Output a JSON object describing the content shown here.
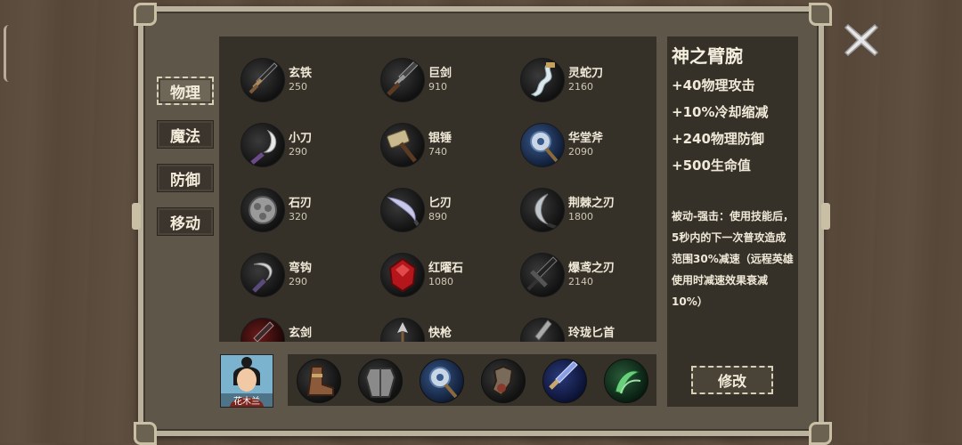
{
  "tabs": [
    {
      "label": "物理",
      "active": true
    },
    {
      "label": "魔法",
      "active": false
    },
    {
      "label": "防御",
      "active": false
    },
    {
      "label": "移动",
      "active": false
    }
  ],
  "items": [
    {
      "name": "玄铁",
      "price": "250",
      "icon": "dark-sword-icon"
    },
    {
      "name": "巨剑",
      "price": "910",
      "icon": "greatsword-icon"
    },
    {
      "name": "灵蛇刀",
      "price": "2160",
      "icon": "serpent-blade-icon"
    },
    {
      "name": "小刀",
      "price": "290",
      "icon": "small-knife-icon"
    },
    {
      "name": "银锤",
      "price": "740",
      "icon": "silver-hammer-icon"
    },
    {
      "name": "华堂斧",
      "price": "2090",
      "icon": "ornate-axe-icon"
    },
    {
      "name": "石刃",
      "price": "320",
      "icon": "stone-blade-icon"
    },
    {
      "name": "匕刃",
      "price": "890",
      "icon": "dagger-blade-icon"
    },
    {
      "name": "荆棘之刃",
      "price": "1800",
      "icon": "thorn-blade-icon"
    },
    {
      "name": "弯钩",
      "price": "290",
      "icon": "hook-icon"
    },
    {
      "name": "红曜石",
      "price": "1080",
      "icon": "red-gem-icon"
    },
    {
      "name": "爆鸢之刃",
      "price": "2140",
      "icon": "kite-blade-icon"
    },
    {
      "name": "玄剑",
      "price": "",
      "icon": "dark-blade-icon"
    },
    {
      "name": "快枪",
      "price": "",
      "icon": "spear-icon"
    },
    {
      "name": "玲珑匕首",
      "price": "",
      "icon": "jade-dagger-icon"
    }
  ],
  "detail": {
    "title": "神之臂腕",
    "stats": [
      "+40物理攻击",
      "+10%冷却缩减",
      "+240物理防御",
      "+500生命值"
    ],
    "passive": "被动-强击：使用技能后，5秒内的下一次普攻造成范围30%减速（远程英雄使用时减速效果衰减10%）"
  },
  "edit_label": "修改",
  "hero": {
    "name": "花木兰"
  },
  "equipment": [
    {
      "icon": "boots-icon"
    },
    {
      "icon": "armor-icon"
    },
    {
      "icon": "ornate-axe-icon"
    },
    {
      "icon": "gauntlet-icon"
    },
    {
      "icon": "blue-sword-icon"
    },
    {
      "icon": "green-claw-icon"
    }
  ],
  "colors": {
    "accent": "#d8cfb7",
    "panel": "#5e5648",
    "list_bg": "#353129"
  }
}
